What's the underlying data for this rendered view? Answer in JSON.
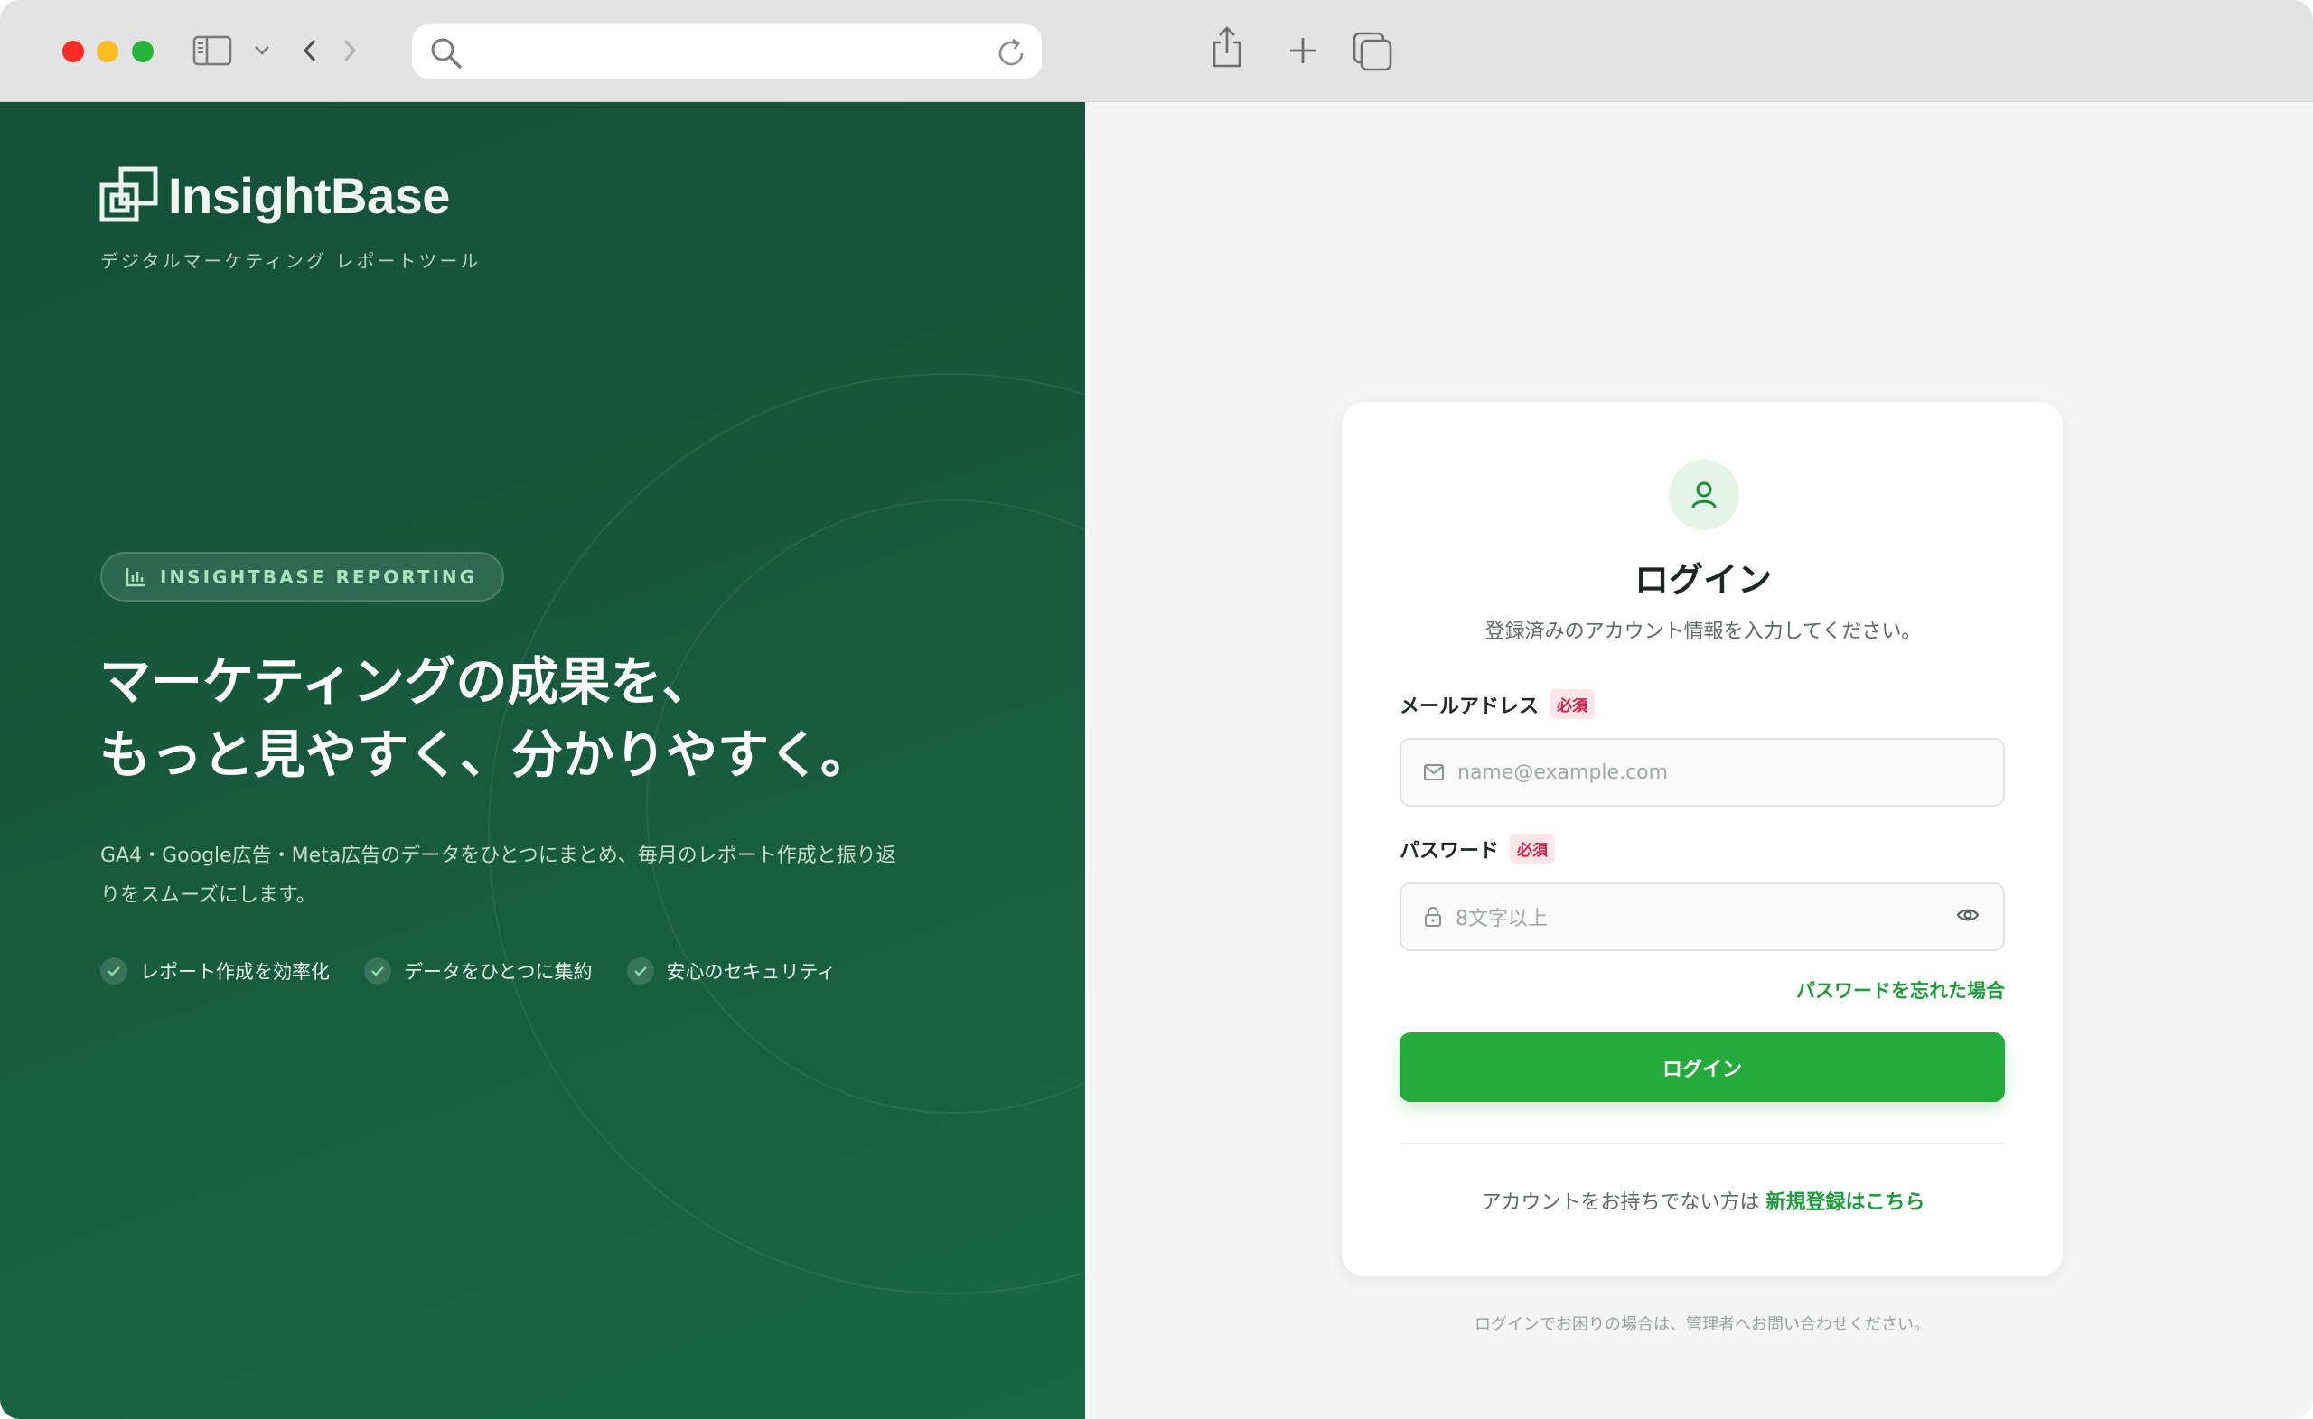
{
  "browser": {
    "url": "",
    "icons": [
      "sidebar-icon",
      "chevron-down-icon",
      "back-icon",
      "forward-icon",
      "search-icon",
      "reload-icon",
      "share-icon",
      "new-tab-icon",
      "tabs-overview-icon"
    ]
  },
  "brand": {
    "name": "InsightBase",
    "tagline": "デジタルマーケティング レポートツール"
  },
  "hero": {
    "badge": "INSIGHTBASE REPORTING",
    "headline_line1": "マーケティングの成果を、",
    "headline_line2": "もっと見やすく、分かりやすく。",
    "description": "GA4・Google広告・Meta広告のデータをひとつにまとめ、毎月のレポート作成と振り返りをスムーズにします。",
    "features": [
      "レポート作成を効率化",
      "データをひとつに集約",
      "安心のセキュリティ"
    ]
  },
  "login": {
    "title": "ログイン",
    "subtitle": "登録済みのアカウント情報を入力してください。",
    "email_label": "メールアドレス",
    "email_placeholder": "name@example.com",
    "password_label": "パスワード",
    "password_placeholder": "8文字以上",
    "required_badge": "必須",
    "forgot_link": "パスワードを忘れた場合",
    "submit": "ログイン",
    "signup_prompt": "アカウントをお持ちでない方は",
    "signup_link": "新規登録はこちら",
    "help_note": "ログインでお困りの場合は、管理者へお問い合わせください。"
  },
  "colors": {
    "brand_green": "#25ab3c",
    "panel_dark": "#14503a",
    "required_red": "#d61f45"
  }
}
